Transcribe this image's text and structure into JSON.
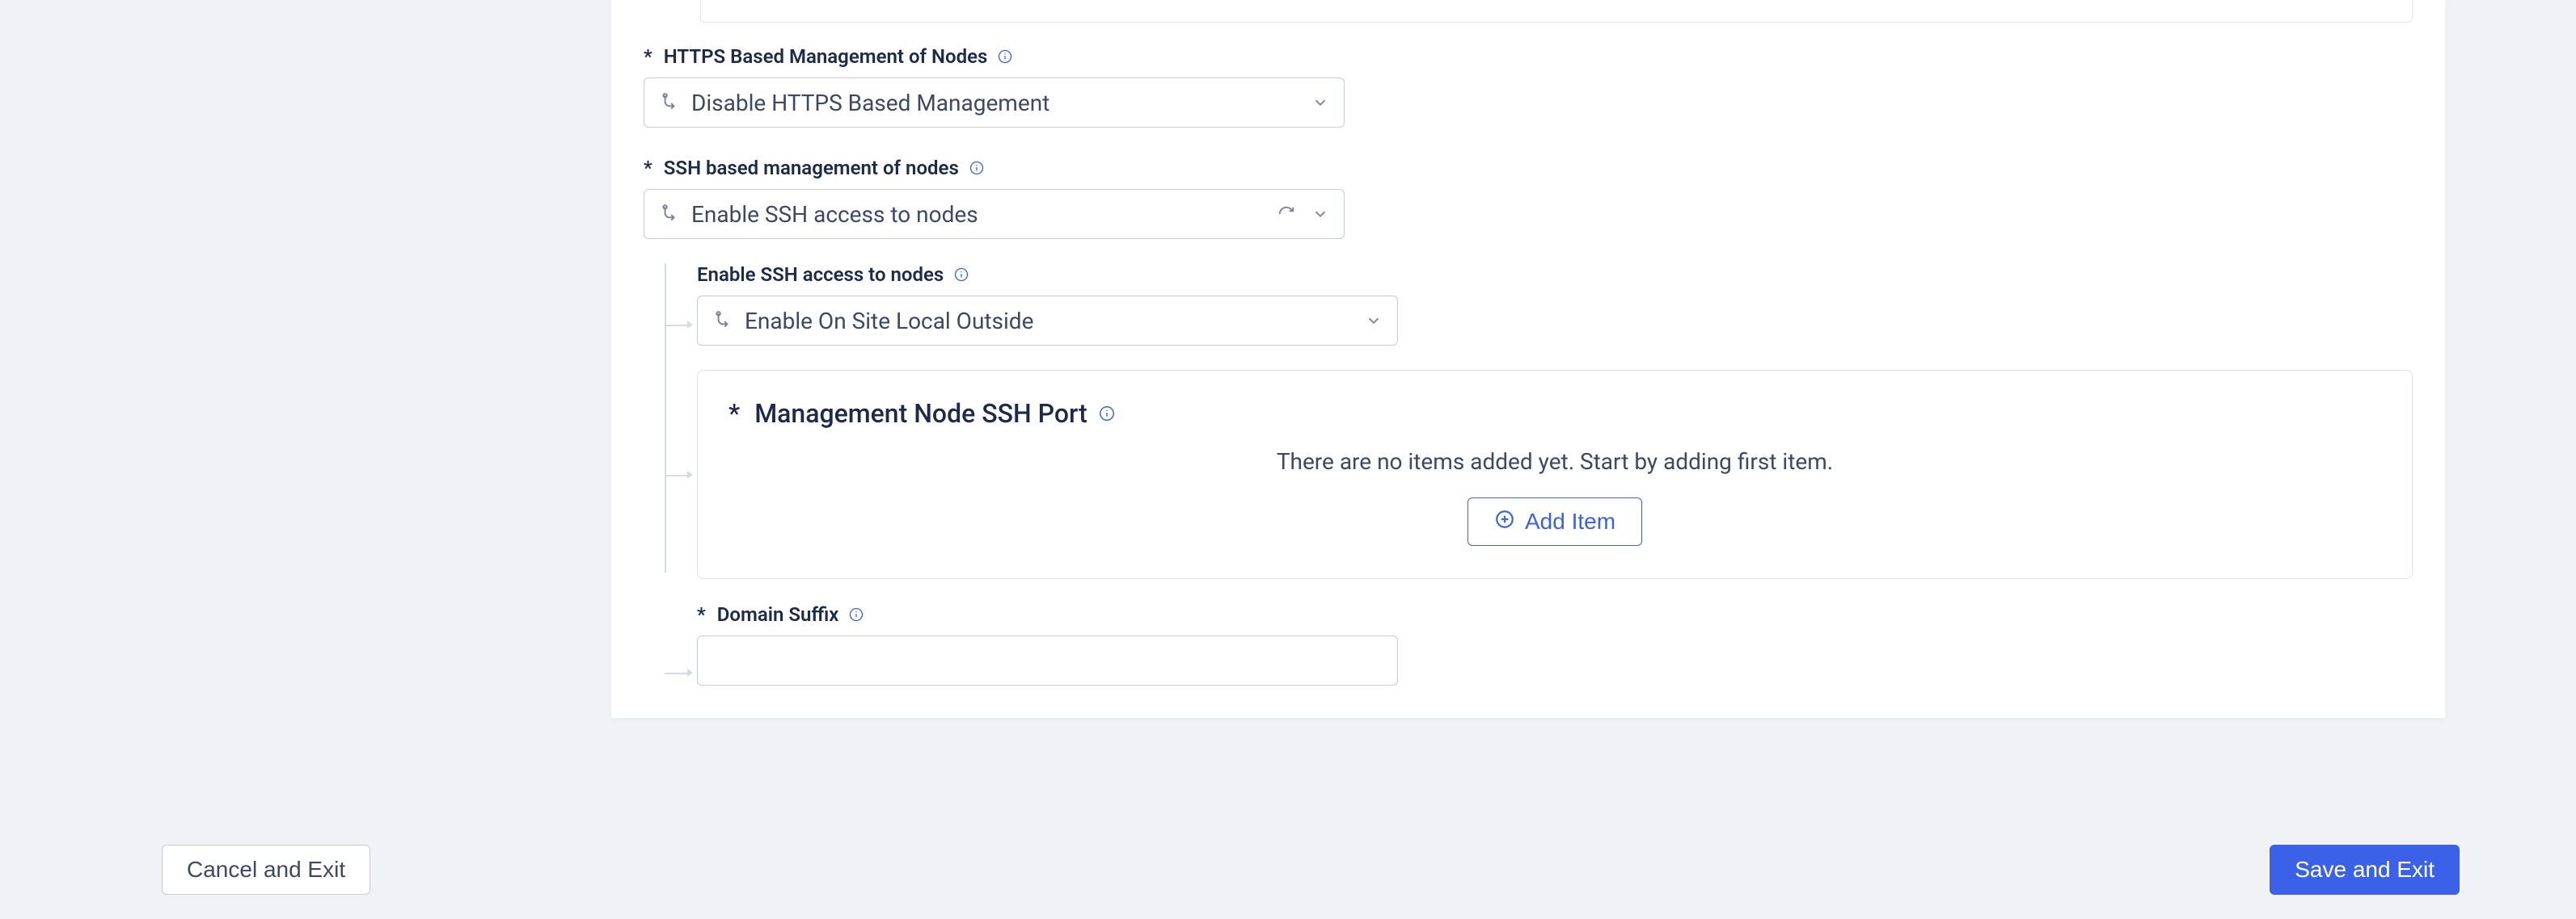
{
  "fields": {
    "https_mgmt": {
      "label": "HTTPS Based Management of Nodes",
      "value": "Disable HTTPS Based Management"
    },
    "ssh_mgmt": {
      "label": "SSH based management of nodes",
      "value": "Enable SSH access to nodes",
      "children": {
        "enable_ssh_access": {
          "label": "Enable SSH access to nodes",
          "value": "Enable On Site Local Outside"
        },
        "ssh_port_panel": {
          "title": "Management Node SSH Port",
          "empty_text": "There are no items added yet. Start by adding first item.",
          "add_label": "Add Item"
        },
        "domain_suffix": {
          "label": "Domain Suffix",
          "value": ""
        }
      }
    }
  },
  "footer": {
    "cancel_label": "Cancel and Exit",
    "save_label": "Save and Exit"
  }
}
